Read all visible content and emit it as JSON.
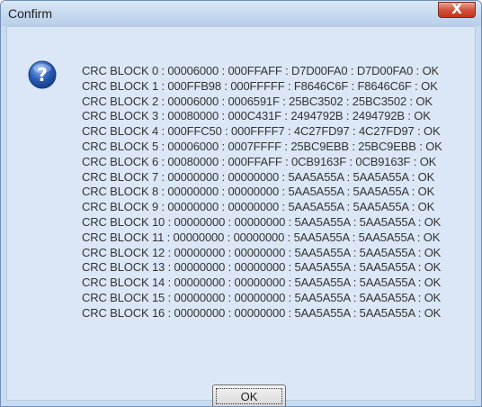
{
  "dialog": {
    "title": "Confirm",
    "close_label": "X",
    "icon": "question-icon",
    "watermark_text": "",
    "lines": [
      "CRC BLOCK 0 : 00006000 : 000FFAFF : D7D00FA0 : D7D00FA0 : OK",
      "CRC BLOCK 1 : 000FFB98 : 000FFFFF : F8646C6F : F8646C6F : OK",
      "CRC BLOCK 2 : 00006000 : 0006591F : 25BC3502 : 25BC3502 : OK",
      "CRC BLOCK 3 : 00080000 : 000C431F : 2494792B : 2494792B : OK",
      "CRC BLOCK 4 : 000FFC50 : 000FFFF7 : 4C27FD97 : 4C27FD97 : OK",
      "CRC BLOCK 5 : 00006000 : 0007FFFF : 25BC9EBB : 25BC9EBB : OK",
      "CRC BLOCK 6 : 00080000 : 000FFAFF : 0CB9163F : 0CB9163F : OK",
      "CRC BLOCK 7 : 00000000 : 00000000 : 5AA5A55A : 5AA5A55A : OK",
      "CRC BLOCK 8 : 00000000 : 00000000 : 5AA5A55A : 5AA5A55A : OK",
      "CRC BLOCK 9 : 00000000 : 00000000 : 5AA5A55A : 5AA5A55A : OK",
      "CRC BLOCK 10 : 00000000 : 00000000 : 5AA5A55A : 5AA5A55A : OK",
      "CRC BLOCK 11 : 00000000 : 00000000 : 5AA5A55A : 5AA5A55A : OK",
      "CRC BLOCK 12 : 00000000 : 00000000 : 5AA5A55A : 5AA5A55A : OK",
      "CRC BLOCK 13 : 00000000 : 00000000 : 5AA5A55A : 5AA5A55A : OK",
      "CRC BLOCK 14 : 00000000 : 00000000 : 5AA5A55A : 5AA5A55A : OK",
      "CRC BLOCK 15 : 00000000 : 00000000 : 5AA5A55A : 5AA5A55A : OK",
      "CRC BLOCK 16 : 00000000 : 00000000 : 5AA5A55A : 5AA5A55A : OK"
    ],
    "ok_label": "OK"
  },
  "colors": {
    "window_frame": "#c9dbee",
    "client_background": "#dbe7f6",
    "close_button": "#c2341c",
    "icon_blue": "#2b5fb8"
  }
}
